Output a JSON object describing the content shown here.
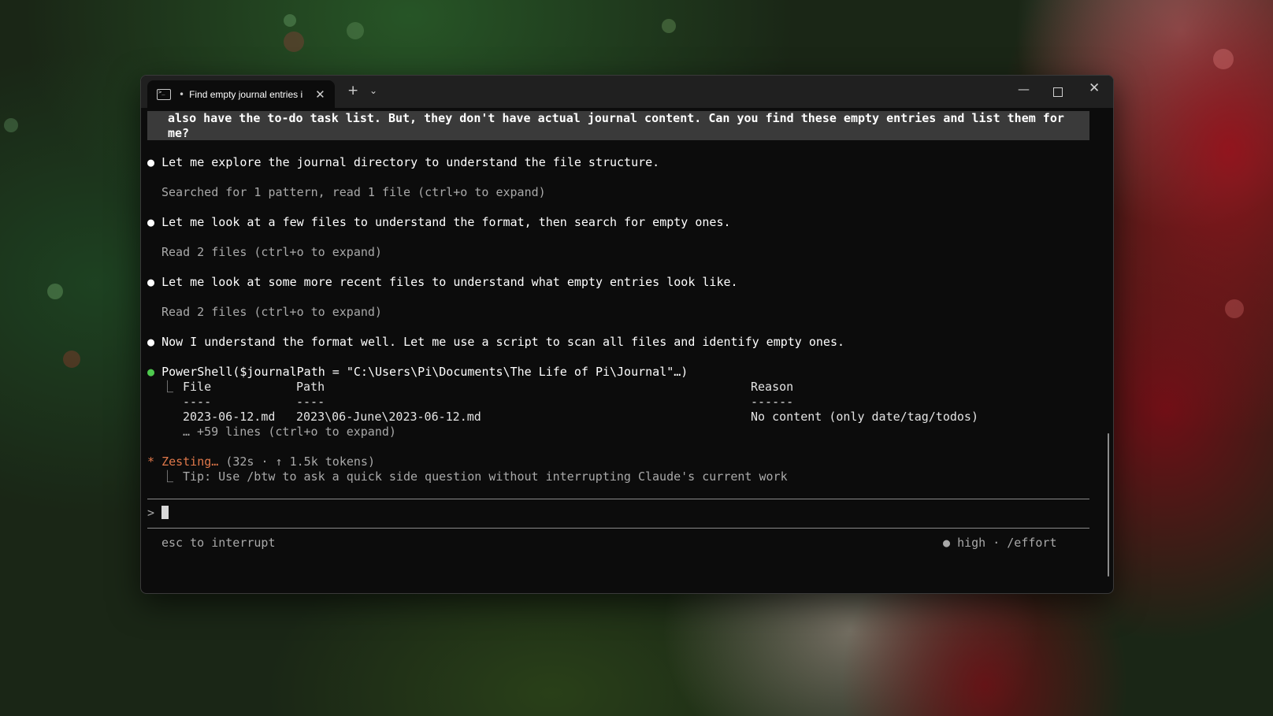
{
  "tab": {
    "title": "Find empty journal entries i",
    "dot": "•",
    "icon": "terminal-icon"
  },
  "titlebar": {
    "new_tab": "+",
    "dropdown": "⌄",
    "minimize": "—",
    "close": "✕"
  },
  "prompt_text": "also have the to-do task list. But, they don't have actual journal content. Can you find these empty entries and list them for\nme?",
  "messages": [
    {
      "bullet": "●",
      "text": "Let me explore the journal directory to understand the file structure."
    },
    {
      "detail": "Searched for 1 pattern, read 1 file (ctrl+o to expand)"
    },
    {
      "bullet": "●",
      "text": "Let me look at a few files to understand the format, then search for empty ones."
    },
    {
      "detail": "Read 2 files (ctrl+o to expand)"
    },
    {
      "bullet": "●",
      "text": "Let me look at some more recent files to understand what empty entries look like."
    },
    {
      "detail": "Read 2 files (ctrl+o to expand)"
    },
    {
      "bullet": "●",
      "text": "Now I understand the format well. Let me use a script to scan all files and identify empty ones."
    }
  ],
  "tool": {
    "bullet": "●",
    "call": "PowerShell($journalPath = \"C:\\Users\\Pi\\Documents\\The Life of Pi\\Journal\"…)",
    "tree": "⎿",
    "headers": [
      "File",
      "Path",
      "Reason"
    ],
    "underlines": [
      "----",
      "----",
      "------"
    ],
    "row": [
      "2023-06-12.md",
      "2023\\06-June\\2023-06-12.md",
      "No content (only date/tag/todos)"
    ],
    "more": "… +59 lines (ctrl+o to expand)"
  },
  "status": {
    "star": "*",
    "verb": "Zesting…",
    "meta": "(32s · ↑ 1.5k tokens)",
    "tree": "⎿",
    "tip": "Tip: Use /btw to ask a quick side question without interrupting Claude's current work"
  },
  "input": {
    "prompt": ">"
  },
  "footer": {
    "left": "esc to interrupt",
    "effort_dot": "●",
    "effort": "high · /effort"
  }
}
